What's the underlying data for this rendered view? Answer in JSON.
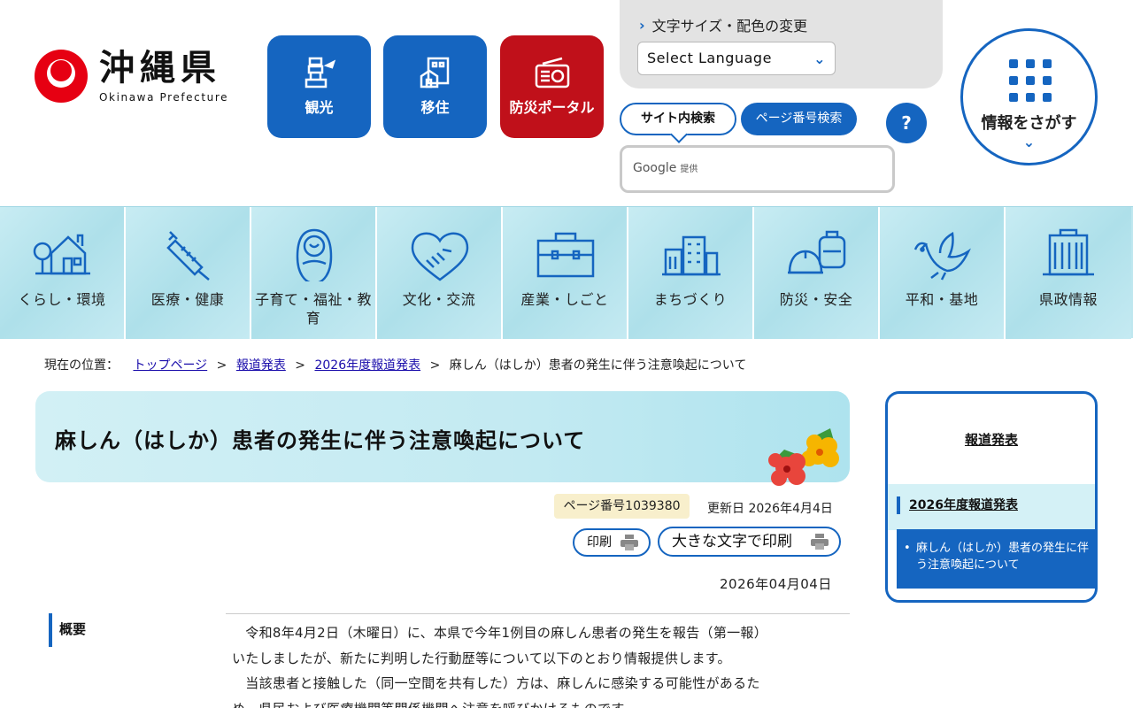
{
  "header": {
    "logo": {
      "name": "沖縄県",
      "english": "Okinawa Prefecture"
    },
    "shortcuts": [
      {
        "label": "観光",
        "icon": "tower-icon",
        "color": "#1565c0"
      },
      {
        "label": "移住",
        "icon": "house-icon",
        "color": "#1565c0"
      },
      {
        "label": "防災ポータル",
        "icon": "radio-icon",
        "color": "#c0101a"
      }
    ],
    "font_color_link": "文字サイズ・配色の変更",
    "language_select": "Select Language",
    "search_tabs": {
      "site": "サイト内検索",
      "page": "ページ番号検索"
    },
    "help": "?",
    "search_provider": {
      "brand": "Google",
      "suffix": "提供"
    },
    "info_button": "情報をさがす"
  },
  "gnav": [
    {
      "label": "くらし・環境",
      "icon": "house-tree-icon"
    },
    {
      "label": "医療・健康",
      "icon": "syringe-icon"
    },
    {
      "label": "子育て・福祉・教育",
      "icon": "baby-icon"
    },
    {
      "label": "文化・交流",
      "icon": "heart-handshake-icon"
    },
    {
      "label": "産業・しごと",
      "icon": "briefcase-icon"
    },
    {
      "label": "まちづくり",
      "icon": "buildings-icon"
    },
    {
      "label": "防災・安全",
      "icon": "helmet-bag-icon"
    },
    {
      "label": "平和・基地",
      "icon": "dove-icon"
    },
    {
      "label": "県政情報",
      "icon": "office-building-icon"
    }
  ],
  "breadcrumb": {
    "lead": "現在の位置：",
    "links": [
      "トップページ",
      "報道発表",
      "2026年度報道発表"
    ],
    "current": "麻しん（はしか）患者の発生に伴う注意喚起について",
    "separator": ">"
  },
  "article": {
    "title": "麻しん（はしか）患者の発生に伴う注意喚起について",
    "page_number": "ページ番号1039380",
    "updated": "更新日 2026年4月4日",
    "print": "印刷",
    "print_large": "大きな文字で印刷",
    "date": "2026年04月04日",
    "summary_heading": "概要",
    "summary_lines": [
      "　令和8年4月2日（木曜日）に、本県で今年1例目の麻しん患者の発生を報告（第一報）",
      "いたしましたが、新たに判明した行動歴等について以下のとおり情報提供します。",
      "　当該患者と接触した（同一空間を共有した）方は、麻しんに感染する可能性があるた",
      "め、県民および医療機関等関係機関へ注意を呼びかけるものです。"
    ]
  },
  "sidebar": {
    "heading": "報道発表",
    "subheading": "2026年度報道発表",
    "current": "麻しん（はしか）患者の発生に伴う注意喚起について"
  },
  "colors": {
    "primary": "#1565c0",
    "danger": "#c0101a",
    "nav_bg": "#bfe7ef",
    "logo_red": "#e60012"
  }
}
